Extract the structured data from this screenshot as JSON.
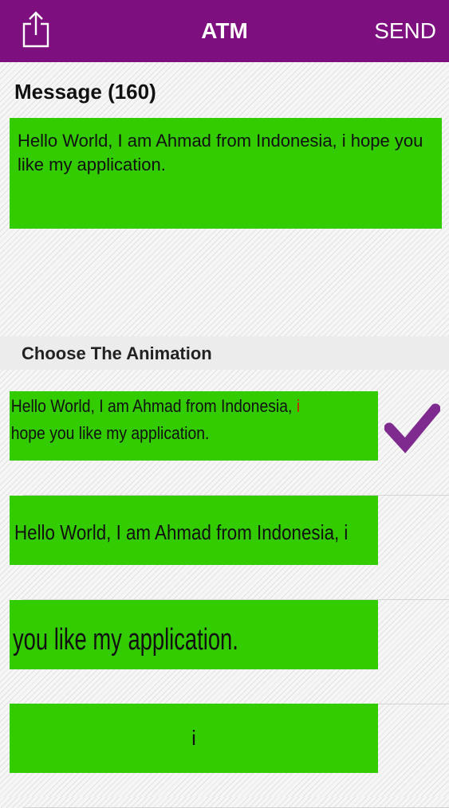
{
  "navbar": {
    "title": "ATM",
    "send_label": "SEND",
    "share_icon": "share-icon",
    "background_color": "#7d0f7f"
  },
  "message": {
    "heading": "Message (160)",
    "text": "Hello World, I am Ahmad from Indonesia, i hope you like my application.",
    "box_color": "#33cc00"
  },
  "animation_section": {
    "title": "Choose The Animation",
    "items": [
      {
        "line_1": "Hello World, I am Ahmad from Indonesia,",
        "line_1_accent": "i",
        "line_2": "hope you like my application.",
        "selected": true
      },
      {
        "text": "Hello World, I am Ahmad from Indonesia, i",
        "selected": false
      },
      {
        "text": "you like my application.",
        "selected": false
      },
      {
        "text": "i",
        "selected": false
      }
    ],
    "selected_icon": "checkmark-icon",
    "accent_color": "#cc2200",
    "check_color": "#7e2a8e"
  }
}
